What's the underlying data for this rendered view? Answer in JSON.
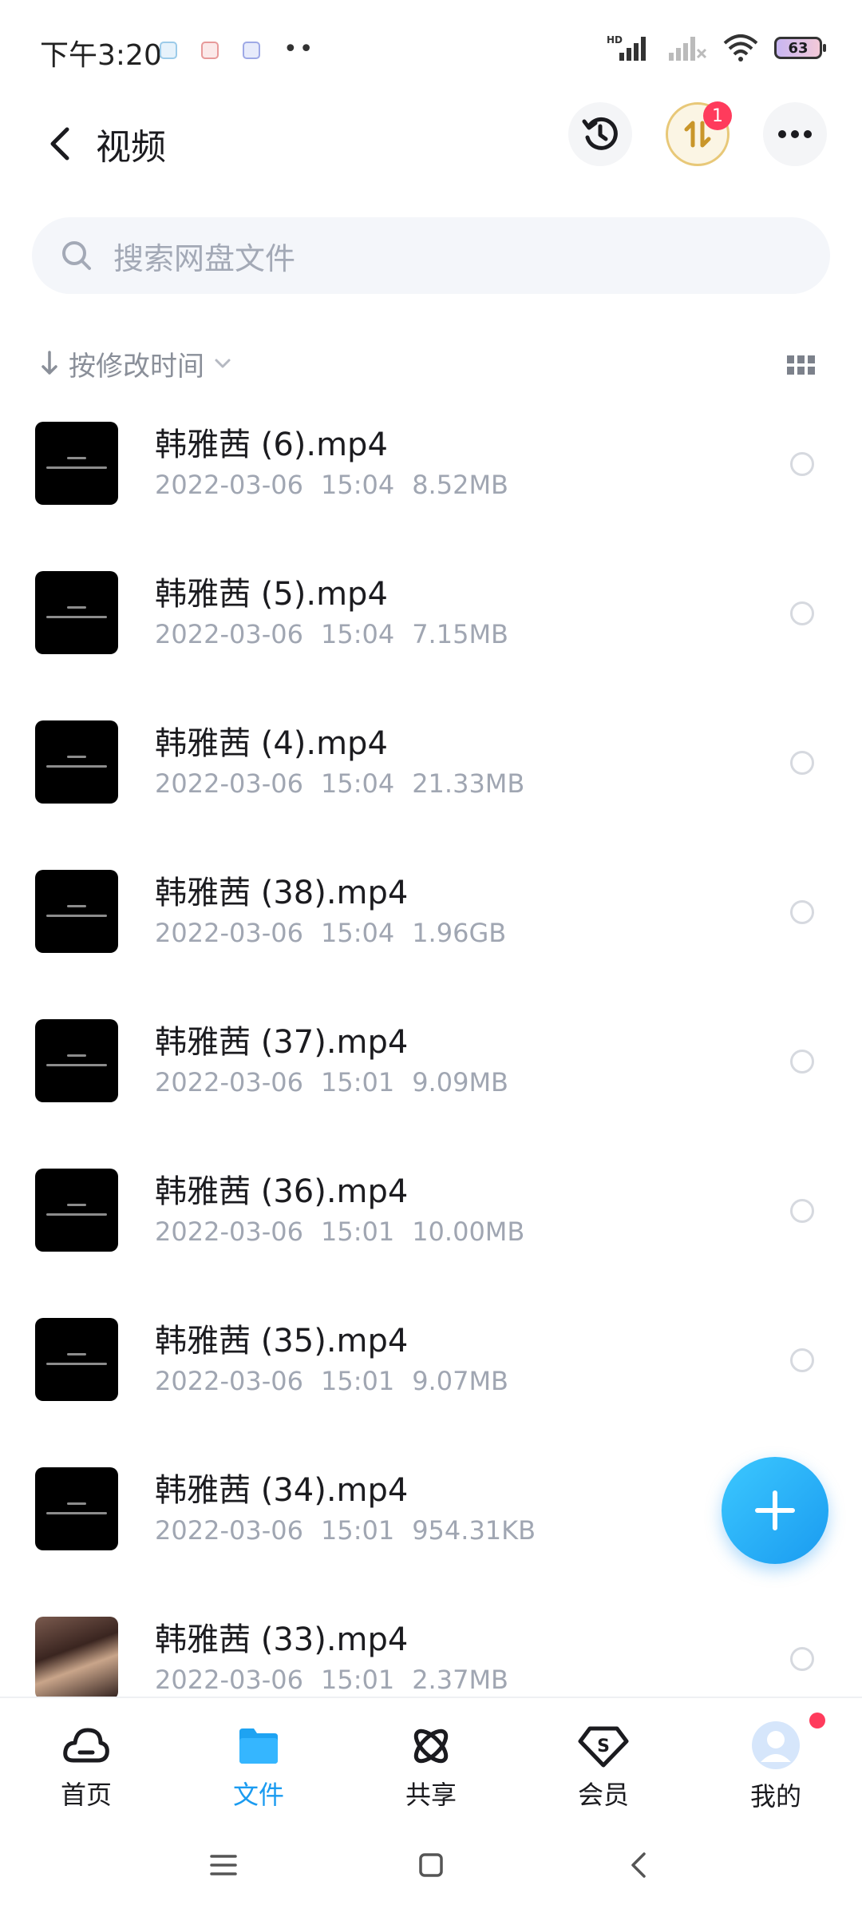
{
  "status_bar": {
    "time": "下午3:20",
    "dots": "••",
    "network": "HD",
    "battery": "63"
  },
  "header": {
    "title": "视频",
    "transfer_badge": "1"
  },
  "search": {
    "placeholder": "搜索网盘文件"
  },
  "sort": {
    "label": "按修改时间"
  },
  "files": [
    {
      "name": "韩雅茜 (6).mp4",
      "date": "2022-03-06",
      "time": "15:04",
      "size": "8.52MB",
      "thumb": "video"
    },
    {
      "name": "韩雅茜 (5).mp4",
      "date": "2022-03-06",
      "time": "15:04",
      "size": "7.15MB",
      "thumb": "video"
    },
    {
      "name": "韩雅茜 (4).mp4",
      "date": "2022-03-06",
      "time": "15:04",
      "size": "21.33MB",
      "thumb": "video"
    },
    {
      "name": "韩雅茜 (38).mp4",
      "date": "2022-03-06",
      "time": "15:04",
      "size": "1.96GB",
      "thumb": "video"
    },
    {
      "name": "韩雅茜 (37).mp4",
      "date": "2022-03-06",
      "time": "15:01",
      "size": "9.09MB",
      "thumb": "video"
    },
    {
      "name": "韩雅茜 (36).mp4",
      "date": "2022-03-06",
      "time": "15:01",
      "size": "10.00MB",
      "thumb": "video"
    },
    {
      "name": "韩雅茜 (35).mp4",
      "date": "2022-03-06",
      "time": "15:01",
      "size": "9.07MB",
      "thumb": "video"
    },
    {
      "name": "韩雅茜 (34).mp4",
      "date": "2022-03-06",
      "time": "15:01",
      "size": "954.31KB",
      "thumb": "video"
    },
    {
      "name": "韩雅茜 (33).mp4",
      "date": "2022-03-06",
      "time": "15:01",
      "size": "2.37MB",
      "thumb": "photo"
    }
  ],
  "bottom_nav": [
    {
      "label": "首页",
      "icon": "cloud-home-icon",
      "active": false
    },
    {
      "label": "文件",
      "icon": "folder-icon",
      "active": true
    },
    {
      "label": "共享",
      "icon": "atom-share-icon",
      "active": false
    },
    {
      "label": "会员",
      "icon": "diamond-s-icon",
      "active": false
    },
    {
      "label": "我的",
      "icon": "avatar-icon",
      "active": false
    }
  ],
  "colors": {
    "accent": "#1a9bf0",
    "badge": "#ff3b5c",
    "meta_text": "#a0a6b2"
  }
}
